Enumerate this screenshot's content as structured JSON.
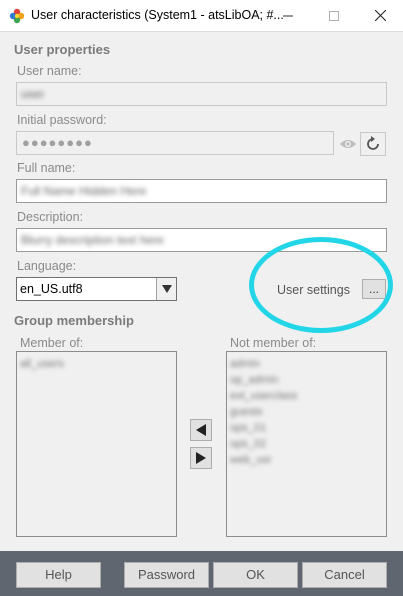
{
  "window": {
    "title": "User characteristics (System1 - atsLibOA; #...",
    "icon": "app-flower-icon",
    "controls": {
      "minimize": "minimize-icon",
      "maximize": "maximize-icon",
      "close": "close-icon"
    }
  },
  "user_properties": {
    "section_title": "User properties",
    "user_name": {
      "label": "User name:",
      "value": "user"
    },
    "initial_password": {
      "label": "Initial password:",
      "value": "●●●●●●●●",
      "show_icon": "eye-icon",
      "reset_icon": "refresh-icon"
    },
    "full_name": {
      "label": "Full name:",
      "value": "Full Name Hidden Here"
    },
    "description": {
      "label": "Description:",
      "value": "Blurry description text here"
    },
    "language": {
      "label": "Language:",
      "selected": "en_US.utf8"
    },
    "user_settings": {
      "label": "User settings",
      "button": "..."
    }
  },
  "group_membership": {
    "section_title": "Group membership",
    "member_of": {
      "label": "Member of:",
      "items": [
        "all_users"
      ]
    },
    "not_member_of": {
      "label": "Not member of:",
      "items": [
        "admin",
        "op_admin",
        "ext_userclass",
        "guests",
        "ops_01",
        "ops_02",
        "web_usr"
      ]
    },
    "move_left_icon": "arrow-left-icon",
    "move_right_icon": "arrow-right-icon"
  },
  "footer": {
    "help": "Help",
    "password": "Password",
    "ok": "OK",
    "cancel": "Cancel"
  },
  "colors": {
    "highlight": "#22d6e8",
    "footer": "#5f6670",
    "dialog": "#f0f0f0"
  }
}
